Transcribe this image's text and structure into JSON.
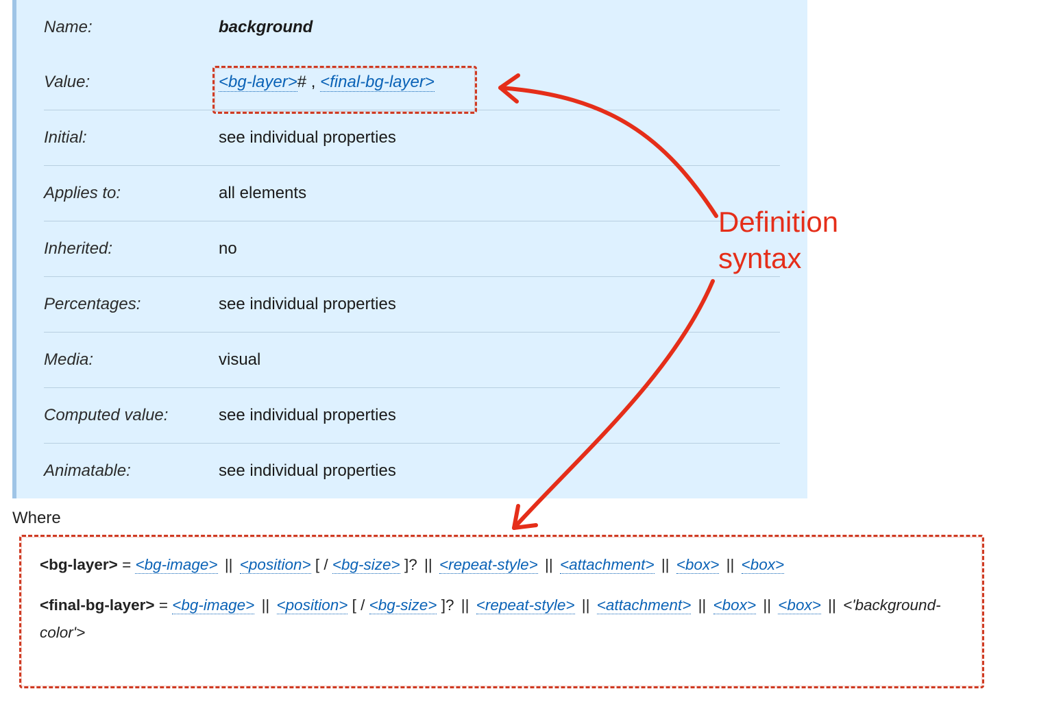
{
  "propdef": {
    "rows": [
      {
        "label": "Name:",
        "value_kind": "name",
        "value": "background"
      },
      {
        "label": "Value:",
        "value_kind": "syntax",
        "syntax": {
          "parts": [
            {
              "t": "link",
              "text": "<bg-layer>"
            },
            {
              "t": "text",
              "text": "# , "
            },
            {
              "t": "link",
              "text": "<final-bg-layer>"
            }
          ]
        }
      },
      {
        "label": "Initial:",
        "value_kind": "text",
        "value": "see individual properties"
      },
      {
        "label": "Applies to:",
        "value_kind": "text",
        "value": "all elements"
      },
      {
        "label": "Inherited:",
        "value_kind": "text",
        "value": "no"
      },
      {
        "label": "Percentages:",
        "value_kind": "text",
        "value": "see individual properties"
      },
      {
        "label": "Media:",
        "value_kind": "text",
        "value": "visual"
      },
      {
        "label": "Computed value:",
        "value_kind": "text",
        "value": "see individual properties"
      },
      {
        "label": "Animatable:",
        "value_kind": "text",
        "value": "see individual properties"
      }
    ]
  },
  "where_label": "Where",
  "definitions": [
    {
      "name": "<bg-layer>",
      "tokens": [
        {
          "t": "link",
          "text": "<bg-image>"
        },
        {
          "t": "op",
          "text": " || "
        },
        {
          "t": "link",
          "text": "<position>"
        },
        {
          "t": "text",
          "text": " [ / "
        },
        {
          "t": "link",
          "text": "<bg-size>"
        },
        {
          "t": "text",
          "text": " ]? "
        },
        {
          "t": "op",
          "text": "|| "
        },
        {
          "t": "link",
          "text": "<repeat-style>"
        },
        {
          "t": "op",
          "text": " || "
        },
        {
          "t": "link",
          "text": "<attachment>"
        },
        {
          "t": "op",
          "text": " || "
        },
        {
          "t": "link",
          "text": "<box>"
        },
        {
          "t": "op",
          "text": " || "
        },
        {
          "t": "link",
          "text": "<box>"
        }
      ]
    },
    {
      "name": "<final-bg-layer>",
      "tokens": [
        {
          "t": "link",
          "text": "<bg-image>"
        },
        {
          "t": "op",
          "text": " || "
        },
        {
          "t": "link",
          "text": "<position>"
        },
        {
          "t": "text",
          "text": " [ / "
        },
        {
          "t": "link",
          "text": "<bg-size>"
        },
        {
          "t": "text",
          "text": " ]? "
        },
        {
          "t": "op",
          "text": "|| "
        },
        {
          "t": "link",
          "text": "<repeat-style>"
        },
        {
          "t": "op",
          "text": " || "
        },
        {
          "t": "link",
          "text": "<attachment>"
        },
        {
          "t": "op",
          "text": " || "
        },
        {
          "t": "link",
          "text": "<box>"
        },
        {
          "t": "op",
          "text": " || "
        },
        {
          "t": "link",
          "text": "<box>"
        },
        {
          "t": "op",
          "text": " || "
        },
        {
          "t": "lit",
          "text": "<'background-color'>"
        }
      ]
    }
  ],
  "annotation": "Definition\nsyntax",
  "colors": {
    "highlight": "#cf3b23",
    "link": "#0a62b6",
    "table_bg": "#def1ff"
  }
}
